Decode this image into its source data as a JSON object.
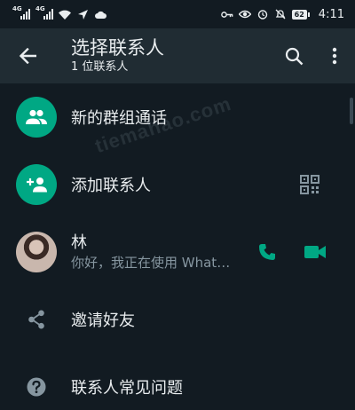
{
  "status_bar": {
    "signal_1": "4G",
    "signal_2": "4G",
    "battery": "62",
    "time": "4:11"
  },
  "app_bar": {
    "title": "选择联系人",
    "subtitle": "1 位联系人"
  },
  "actions": {
    "new_group": "新的群组通话",
    "add_contact": "添加联系人",
    "invite": "邀请好友",
    "help": "联系人常见问题"
  },
  "contact": {
    "name": "林",
    "status": "你好，我正在使用 WhatsApp。"
  },
  "watermark": "tiemahao.com",
  "colors": {
    "background": "#121b22",
    "app_bar": "#202c33",
    "accent": "#00a884"
  }
}
